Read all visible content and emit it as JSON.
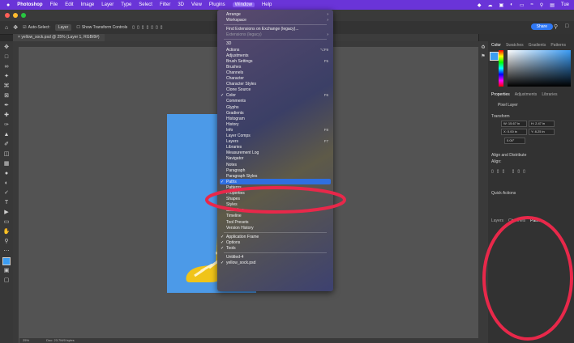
{
  "menubar": {
    "apple": "",
    "app_name": "Photoshop",
    "menus": [
      "File",
      "Edit",
      "Image",
      "Layer",
      "Type",
      "Select",
      "Filter",
      "3D",
      "View",
      "Plugins",
      "Window",
      "Help"
    ],
    "active_menu": "Window",
    "clock": "Tue"
  },
  "options_bar": {
    "auto_select_label": "Auto-Select:",
    "auto_select_value": "Layer",
    "transform_controls": "Show Transform Controls"
  },
  "share_label": "Share",
  "document_tab": "yellow_sock.psd @ 25% (Layer 1, RGB/8#)",
  "status": {
    "zoom": "25%",
    "info": "Doc: 23.7M/0 bytes"
  },
  "window_menu": {
    "top": [
      {
        "label": "Arrange",
        "submenu": true
      },
      {
        "label": "Workspace",
        "submenu": true
      }
    ],
    "extensions": [
      {
        "label": "Find Extensions on Exchange (legacy)...",
        "dim": false
      },
      {
        "label": "Extensions (legacy)",
        "dim": true,
        "submenu": true
      }
    ],
    "items": [
      {
        "label": "3D"
      },
      {
        "label": "Actions",
        "shortcut": "⌥F9"
      },
      {
        "label": "Adjustments"
      },
      {
        "label": "Brush Settings",
        "shortcut": "F5"
      },
      {
        "label": "Brushes"
      },
      {
        "label": "Channels"
      },
      {
        "label": "Character"
      },
      {
        "label": "Character Styles"
      },
      {
        "label": "Clone Source"
      },
      {
        "label": "Color",
        "checked": true,
        "shortcut": "F6"
      },
      {
        "label": "Comments"
      },
      {
        "label": "Glyphs"
      },
      {
        "label": "Gradients"
      },
      {
        "label": "Histogram"
      },
      {
        "label": "History"
      },
      {
        "label": "Info",
        "shortcut": "F8"
      },
      {
        "label": "Layer Comps"
      },
      {
        "label": "Layers",
        "shortcut": "F7"
      },
      {
        "label": "Libraries"
      },
      {
        "label": "Measurement Log"
      },
      {
        "label": "Navigator"
      },
      {
        "label": "Notes"
      },
      {
        "label": "Paragraph"
      },
      {
        "label": "Paragraph Styles"
      },
      {
        "label": "Paths",
        "checked": true,
        "highlighted": true
      },
      {
        "label": "Patterns"
      },
      {
        "label": "Properties",
        "checked": true
      },
      {
        "label": "Shapes"
      },
      {
        "label": "Styles"
      },
      {
        "label": "Swatches"
      },
      {
        "label": "Timeline"
      },
      {
        "label": "Tool Presets"
      },
      {
        "label": "Version History"
      }
    ],
    "bottom": [
      {
        "label": "Application Frame",
        "checked": true
      },
      {
        "label": "Options",
        "checked": true
      },
      {
        "label": "Tools",
        "checked": true
      }
    ],
    "documents": [
      {
        "label": "Untitled-4"
      },
      {
        "label": "yellow_sock.psd",
        "checked": true
      }
    ]
  },
  "right_panels": {
    "color_tabs": [
      "Color",
      "Swatches",
      "Gradients",
      "Patterns"
    ],
    "properties_tabs": [
      "Properties",
      "Adjustments",
      "Libraries"
    ],
    "pixel_layer": "Pixel Layer",
    "transform_label": "Transform",
    "w": "W: 15.67 in",
    "h": "H: 2.47 in",
    "x": "X: 0.00 in",
    "y": "Y: 8.25 in",
    "angle": "0.00°",
    "align_label": "Align and Distribute",
    "align_sub": "Align:",
    "quick_actions": "Quick Actions",
    "paths_tabs": [
      "Layers",
      "Channels",
      "Paths"
    ]
  },
  "annotation_color": "#e8284a"
}
